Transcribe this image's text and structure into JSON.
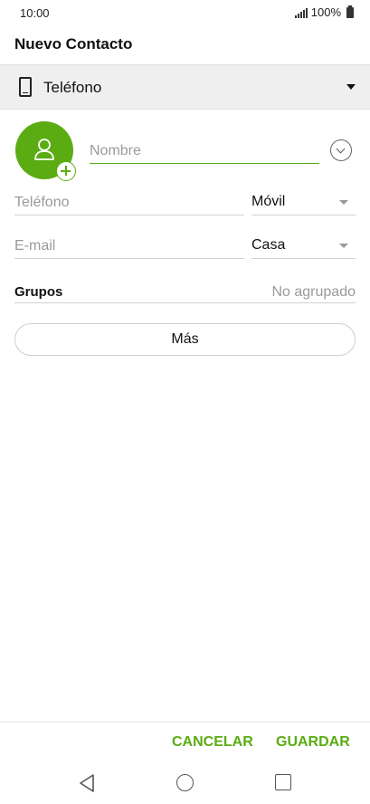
{
  "status_bar": {
    "time": "10:00",
    "battery": "100%"
  },
  "header": {
    "title": "Nuevo Contacto"
  },
  "account": {
    "label": "Teléfono",
    "icon": "phone-icon"
  },
  "form": {
    "name_placeholder": "Nombre",
    "phone_placeholder": "Teléfono",
    "phone_type": "Móvil",
    "email_placeholder": "E-mail",
    "email_type": "Casa",
    "groups_label": "Grupos",
    "groups_value": "No agrupado",
    "more_label": "Más"
  },
  "actions": {
    "cancel_label": "CANCELAR",
    "save_label": "GUARDAR"
  },
  "colors": {
    "accent": "#5aac12",
    "account_bar": "#efefef"
  }
}
